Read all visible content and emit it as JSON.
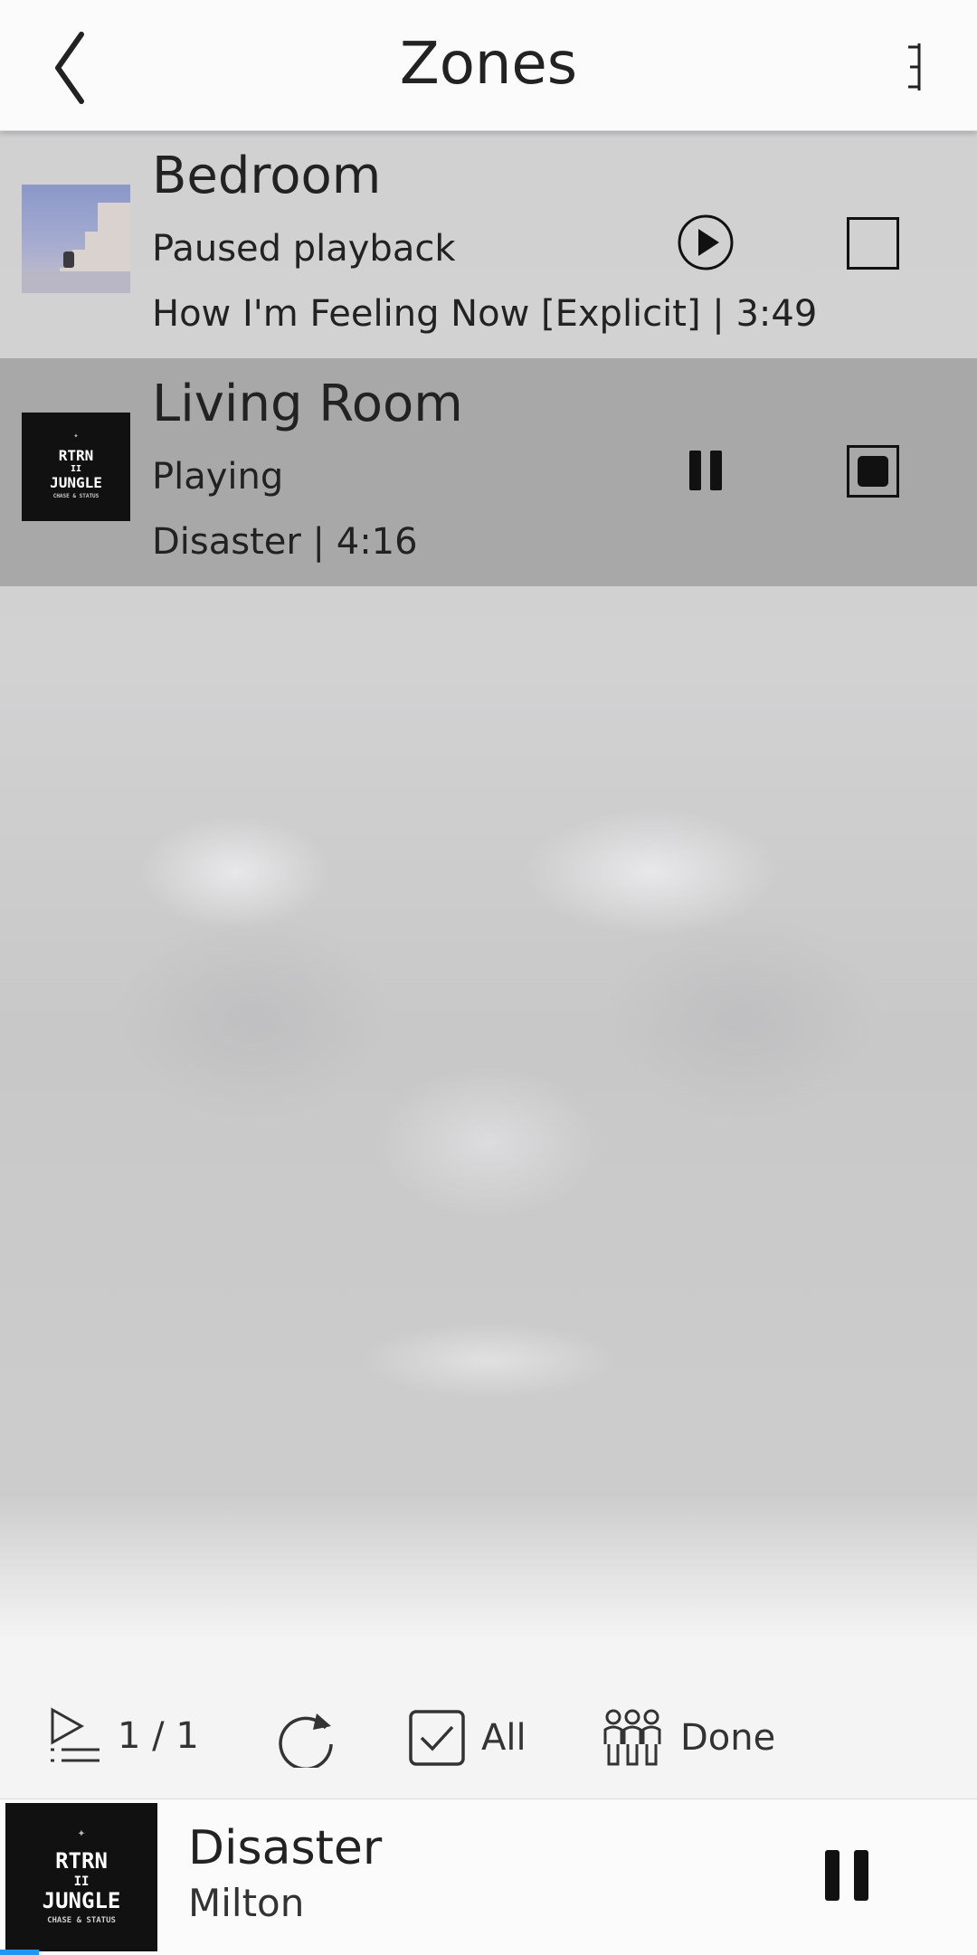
{
  "header": {
    "title": "Zones",
    "back_icon": "chevron-left-icon",
    "menu_icon": "overflow-menu-icon"
  },
  "zones": [
    {
      "name": "Bedroom",
      "status": "Paused playback",
      "track": "How I'm Feeling Now [Explicit]  |  3:49",
      "state": "paused",
      "control_icon": "play-icon",
      "stop_icon": "stop-icon",
      "selected": false
    },
    {
      "name": "Living Room",
      "status": "Playing",
      "track": "Disaster  |  4:16",
      "state": "playing",
      "control_icon": "pause-icon",
      "stop_icon": "stop-icon",
      "selected": true
    }
  ],
  "album_art": {
    "line1": "RTRN",
    "line2": "II",
    "line3": "JUNGLE",
    "line4": "CHASE & STATUS"
  },
  "toolbar": {
    "queue_label": "1 / 1",
    "all_label": "All",
    "all_checked": true,
    "done_label": "Done"
  },
  "now_playing": {
    "title": "Disaster",
    "artist": "Milton",
    "progress": 0.04,
    "accent_color": "#2196f3"
  }
}
